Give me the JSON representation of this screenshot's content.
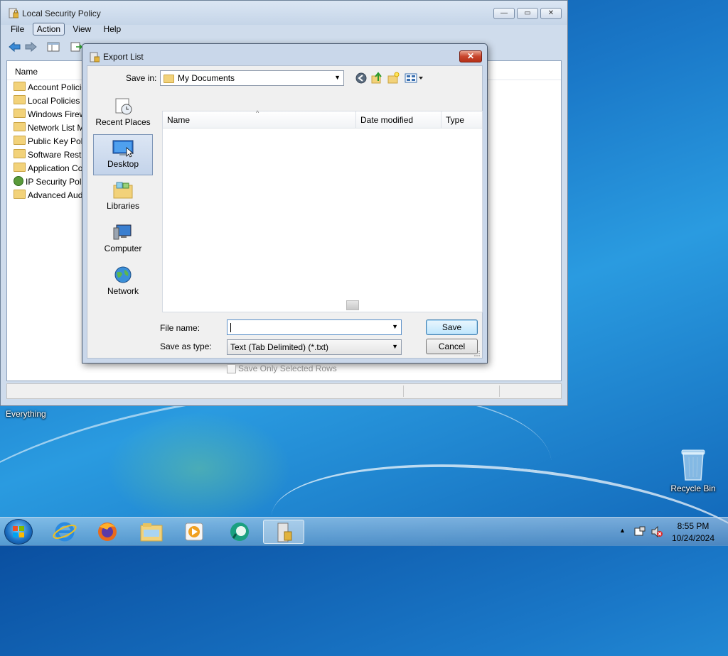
{
  "desktop": {
    "icons": [
      {
        "label": "Everything"
      },
      {
        "label": "Recycle Bin"
      }
    ]
  },
  "main_window": {
    "title": "Local Security Policy",
    "caption_buttons": {
      "minimize": "—",
      "maximize": "▭",
      "close": "✕"
    },
    "menu": [
      "File",
      "Action",
      "View",
      "Help"
    ],
    "active_menu": "Action",
    "column_header": "Name",
    "tree_items": [
      "Account Policie",
      "Local Policies",
      "Windows Firew",
      "Network List M",
      "Public Key Poli",
      "Software Restri",
      "Application Co",
      "IP Security Poli",
      "Advanced Aud"
    ]
  },
  "dialog": {
    "title": "Export List",
    "close_label": "✕",
    "save_in_label": "Save in:",
    "save_in_value": "My Documents",
    "places": [
      "Recent Places",
      "Desktop",
      "Libraries",
      "Computer",
      "Network"
    ],
    "selected_place": "Desktop",
    "columns": [
      "Name",
      "Date modified",
      "Type"
    ],
    "file_name_label": "File name:",
    "file_name_value": "",
    "save_as_type_label": "Save as type:",
    "save_as_type_value": "Text (Tab Delimited) (*.txt)",
    "save_button": "Save",
    "cancel_button": "Cancel",
    "checkbox_label": "Save Only Selected Rows",
    "checkbox_checked": false
  },
  "taskbar": {
    "apps": [
      "internet-explorer",
      "firefox",
      "windows-explorer",
      "media-player",
      "app-green-circle",
      "local-security-policy"
    ],
    "active_app": "local-security-policy",
    "time": "8:55 PM",
    "date": "10/24/2024"
  }
}
